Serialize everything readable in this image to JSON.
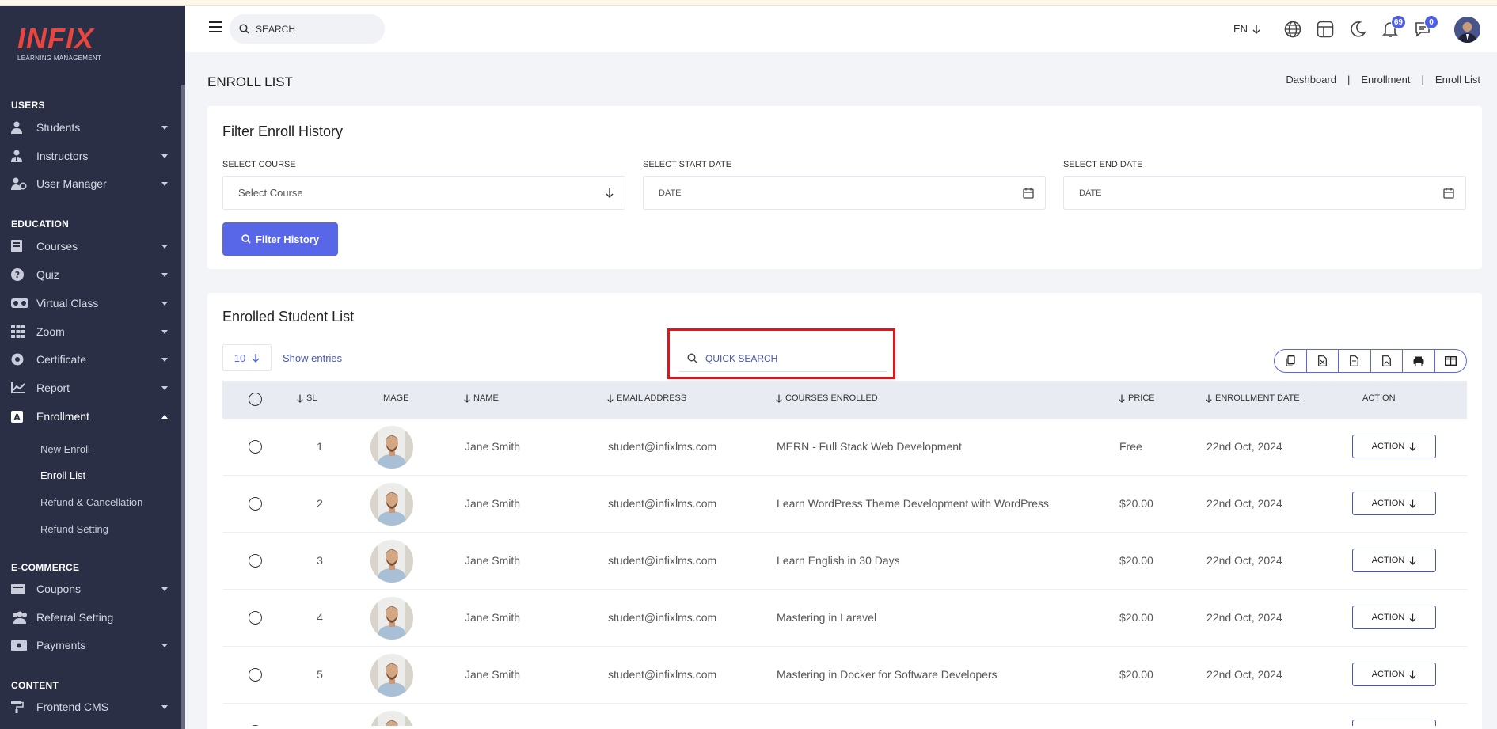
{
  "app": {
    "brand": "INFIX",
    "brand_tagline": "LEARNING MANAGEMENT"
  },
  "sidebar": {
    "sections": [
      {
        "title": "USERS"
      },
      {
        "title": "EDUCATION"
      },
      {
        "title": "E-COMMERCE"
      },
      {
        "title": "CONTENT"
      }
    ],
    "items": [
      {
        "label": "Students",
        "icon": "user-icon"
      },
      {
        "label": "Instructors",
        "icon": "instructor-icon"
      },
      {
        "label": "User Manager",
        "icon": "user-gear-icon"
      },
      {
        "label": "Courses",
        "icon": "book-icon"
      },
      {
        "label": "Quiz",
        "icon": "question-icon"
      },
      {
        "label": "Virtual Class",
        "icon": "vr-icon"
      },
      {
        "label": "Zoom",
        "icon": "grid-icon"
      },
      {
        "label": "Certificate",
        "icon": "certificate-icon"
      },
      {
        "label": "Report",
        "icon": "chart-icon"
      },
      {
        "label": "Enrollment",
        "icon": "enrollment-icon"
      },
      {
        "label": "Coupons",
        "icon": "coupon-icon"
      },
      {
        "label": "Referral Setting",
        "icon": "referral-icon"
      },
      {
        "label": "Payments",
        "icon": "payment-icon"
      },
      {
        "label": "Frontend CMS",
        "icon": "paint-roller-icon"
      }
    ],
    "enrollment_sub": [
      {
        "label": "New Enroll"
      },
      {
        "label": "Enroll List"
      },
      {
        "label": "Refund & Cancellation"
      },
      {
        "label": "Refund Setting"
      }
    ]
  },
  "header": {
    "search_placeholder": "SEARCH",
    "language": "EN",
    "notifications_count": "69",
    "messages_count": "0"
  },
  "page": {
    "title": "ENROLL LIST",
    "breadcrumb": [
      "Dashboard",
      "Enrollment",
      "Enroll List"
    ]
  },
  "filter": {
    "title": "Filter Enroll History",
    "course_label": "SELECT COURSE",
    "course_value": "Select Course",
    "start_label": "SELECT START DATE",
    "start_placeholder": "DATE",
    "end_label": "SELECT END DATE",
    "end_placeholder": "DATE",
    "button": "Filter History"
  },
  "list": {
    "title": "Enrolled Student List",
    "entries_value": "10",
    "show_entries": "Show entries",
    "quick_search_placeholder": "QUICK SEARCH",
    "export_buttons": [
      "copy-icon",
      "csv-icon",
      "excel-icon",
      "pdf-icon",
      "print-icon",
      "columns-icon"
    ],
    "headers": {
      "sl": "SL",
      "image": "IMAGE",
      "name": "NAME",
      "email": "EMAIL ADDRESS",
      "courses": "COURSES ENROLLED",
      "price": "PRICE",
      "date": "ENROLLMENT DATE",
      "action": "ACTION"
    },
    "rows": [
      {
        "sl": "1",
        "name": "Jane Smith",
        "email": "student@infixlms.com",
        "course": "MERN - Full Stack Web Development",
        "price": "Free",
        "date": "22nd Oct, 2024",
        "action": "ACTION"
      },
      {
        "sl": "2",
        "name": "Jane Smith",
        "email": "student@infixlms.com",
        "course": "Learn WordPress Theme Development with WordPress",
        "price": "$20.00",
        "date": "22nd Oct, 2024",
        "action": "ACTION"
      },
      {
        "sl": "3",
        "name": "Jane Smith",
        "email": "student@infixlms.com",
        "course": "Learn English in 30 Days",
        "price": "$20.00",
        "date": "22nd Oct, 2024",
        "action": "ACTION"
      },
      {
        "sl": "4",
        "name": "Jane Smith",
        "email": "student@infixlms.com",
        "course": "Mastering in Laravel",
        "price": "$20.00",
        "date": "22nd Oct, 2024",
        "action": "ACTION"
      },
      {
        "sl": "5",
        "name": "Jane Smith",
        "email": "student@infixlms.com",
        "course": "Mastering in Docker for Software Developers",
        "price": "$20.00",
        "date": "22nd Oct, 2024",
        "action": "ACTION"
      }
    ]
  },
  "colors": {
    "sidebar_bg": "#2a2f45",
    "accent": "#5867e8",
    "brand_red": "#e8463f",
    "highlight_red": "#e1141e"
  }
}
